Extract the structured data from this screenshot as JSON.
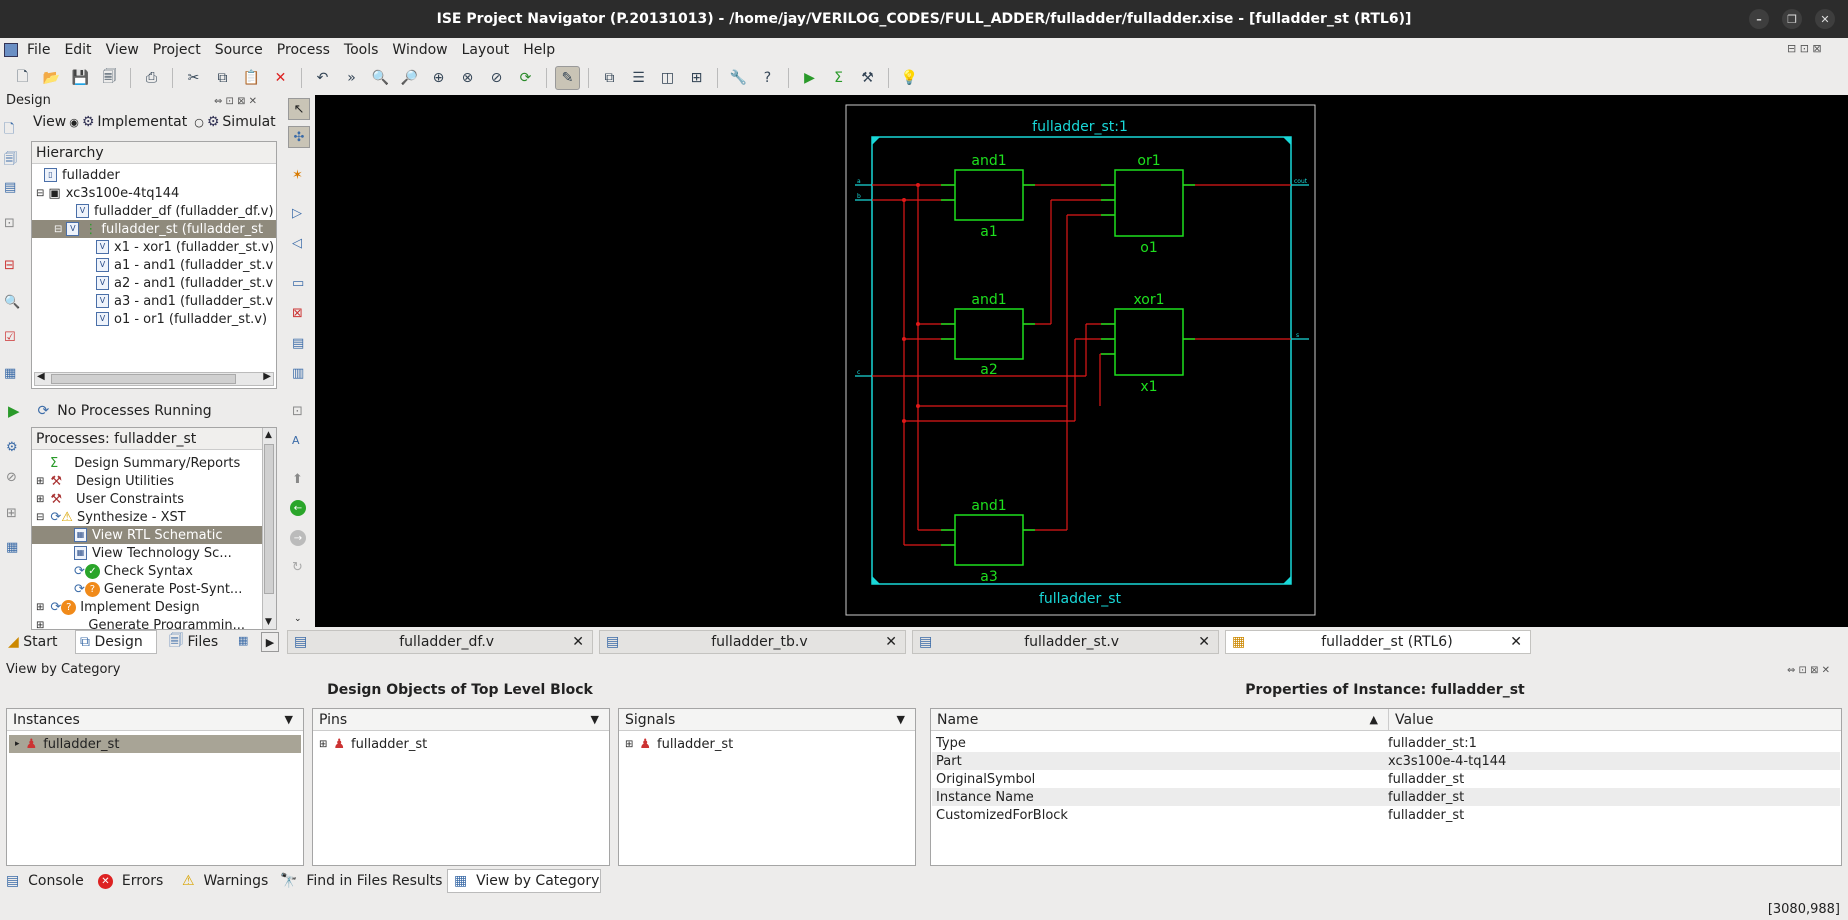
{
  "window": {
    "title": "ISE Project Navigator (P.20131013) - /home/jay/VERILOG_CODES/FULL_ADDER/fulladder/fulladder.xise - [fulladder_st (RTL6)]"
  },
  "menu": [
    "File",
    "Edit",
    "View",
    "Project",
    "Source",
    "Process",
    "Tools",
    "Window",
    "Layout",
    "Help"
  ],
  "design_panel": {
    "title": "Design",
    "view_label": "View",
    "view_impl": "Implementat",
    "view_sim": "Simulat",
    "hierarchy_label": "Hierarchy",
    "tree": [
      {
        "label": "fulladder"
      },
      {
        "label": "xc3s100e-4tq144"
      },
      {
        "label": "fulladder_df (fulladder_df.v)"
      },
      {
        "label": "fulladder_st (fulladder_st"
      },
      {
        "label": "x1 - xor1 (fulladder_st.v)"
      },
      {
        "label": "a1 - and1 (fulladder_st.v"
      },
      {
        "label": "a2 - and1 (fulladder_st.v"
      },
      {
        "label": "a3 - and1 (fulladder_st.v"
      },
      {
        "label": "o1 - or1 (fulladder_st.v)"
      }
    ],
    "no_processes": "No Processes Running",
    "processes_label": "Processes: fulladder_st",
    "processes": [
      {
        "label": "Design Summary/Reports"
      },
      {
        "label": "Design Utilities"
      },
      {
        "label": "User Constraints"
      },
      {
        "label": "Synthesize - XST"
      },
      {
        "label": "View RTL Schematic"
      },
      {
        "label": "View Technology Sc..."
      },
      {
        "label": "Check Syntax"
      },
      {
        "label": "Generate Post-Synt..."
      },
      {
        "label": "Implement Design"
      },
      {
        "label": "Generate Programmin..."
      }
    ],
    "bottom_tabs": [
      "Start",
      "Design",
      "Files"
    ]
  },
  "doc_tabs": [
    "fulladder_df.v",
    "fulladder_tb.v",
    "fulladder_st.v",
    "fulladder_st (RTL6)"
  ],
  "schematic": {
    "top_label": "fulladder_st:1",
    "bottom_label": "fulladder_st",
    "gates": [
      {
        "type": "and1",
        "name": "a1"
      },
      {
        "type": "or1",
        "name": "o1"
      },
      {
        "type": "and1",
        "name": "a2"
      },
      {
        "type": "xor1",
        "name": "x1"
      },
      {
        "type": "and1",
        "name": "a3"
      }
    ],
    "ports": [
      "a",
      "b",
      "c",
      "cout",
      "s"
    ]
  },
  "category": {
    "header": "View by Category",
    "design_objects_title": "Design Objects of Top Level Block",
    "properties_title": "Properties of Instance: fulladder_st",
    "instances_label": "Instances",
    "pins_label": "Pins",
    "signals_label": "Signals",
    "instances_item": "fulladder_st",
    "pins_item": "fulladder_st",
    "signals_item": "fulladder_st",
    "prop_name_col": "Name",
    "prop_value_col": "Value",
    "properties": [
      {
        "name": "Type",
        "value": "fulladder_st:1"
      },
      {
        "name": "Part",
        "value": "xc3s100e-4-tq144"
      },
      {
        "name": "OriginalSymbol",
        "value": "fulladder_st"
      },
      {
        "name": "Instance Name",
        "value": "fulladder_st"
      },
      {
        "name": "CustomizedForBlock",
        "value": "fulladder_st"
      }
    ]
  },
  "bottom_tabs": [
    "Console",
    "Errors",
    "Warnings",
    "Find in Files Results",
    "View by Category"
  ],
  "status": {
    "coords": "[3080,988]"
  }
}
